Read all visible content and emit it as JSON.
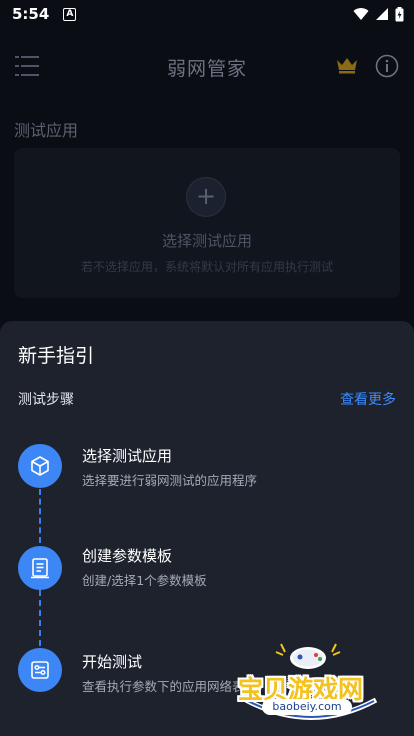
{
  "status_bar": {
    "time": "5:54",
    "notification_letter": "A"
  },
  "app": {
    "title": "弱网管家"
  },
  "background": {
    "section_title": "测试应用",
    "select_card": {
      "plus": "+",
      "title": "选择测试应用",
      "subtitle": "若不选择应用，系统将默认对所有应用执行测试"
    }
  },
  "sheet": {
    "title": "新手指引",
    "steps_label": "测试步骤",
    "more_link": "查看更多",
    "steps": [
      {
        "title": "选择测试应用",
        "desc": "选择要进行弱网测试的应用程序",
        "icon": "cube-icon"
      },
      {
        "title": "创建参数模板",
        "desc": "创建/选择1个参数模板",
        "icon": "document-icon"
      },
      {
        "title": "开始测试",
        "desc": "查看执行参数下的应用网络表现",
        "icon": "settings-sliders-icon"
      }
    ]
  },
  "watermark": {
    "text": "宝贝游戏网",
    "url": "baobeiy.com"
  },
  "colors": {
    "accent": "#3d86f5",
    "link": "#3b8cff",
    "sheet_bg": "#1e222d",
    "crown": "#d9a21a"
  }
}
